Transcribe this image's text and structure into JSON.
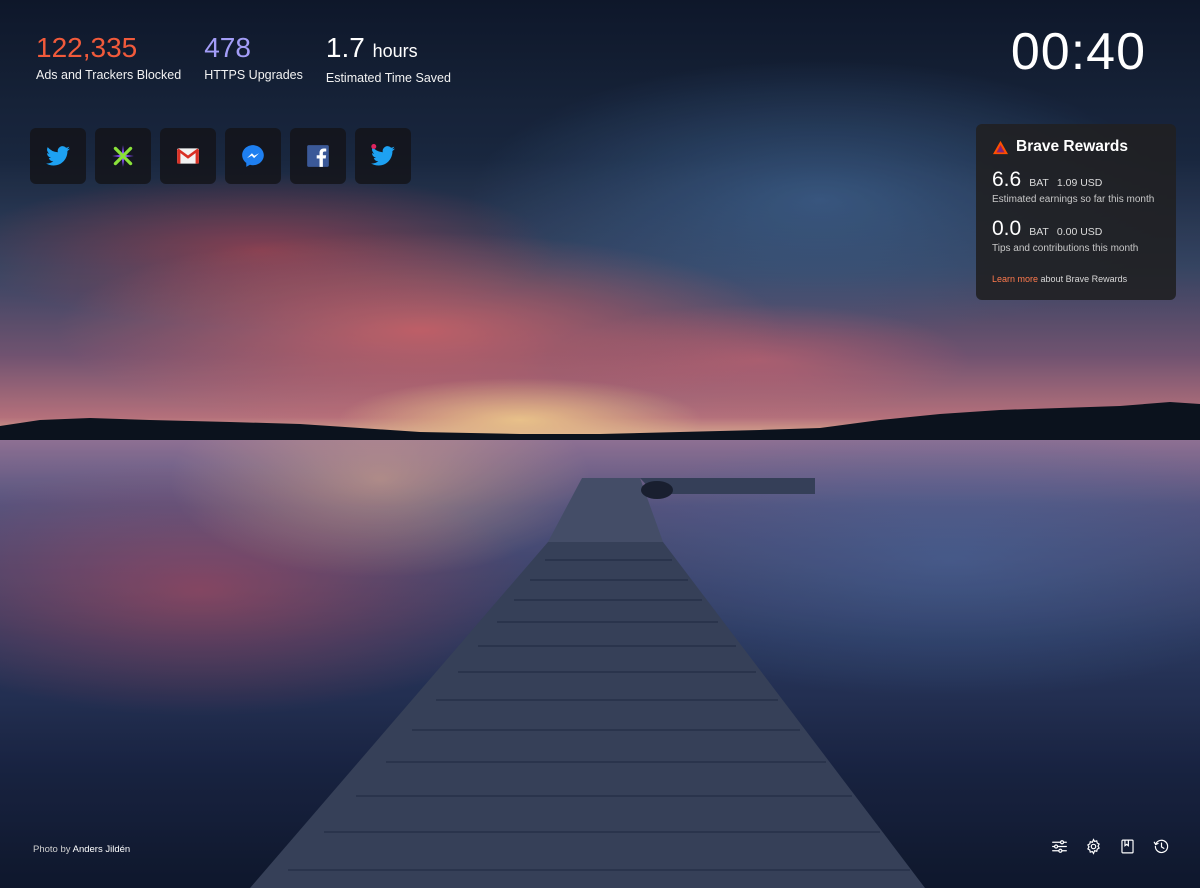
{
  "stats": {
    "ads_blocked": {
      "value": "122,335",
      "label": "Ads and Trackers Blocked",
      "color": "#f15a3b"
    },
    "https_upgrades": {
      "value": "478",
      "label": "HTTPS Upgrades",
      "color": "#a39df7"
    },
    "time_saved": {
      "value": "1.7",
      "unit": "hours",
      "label": "Estimated Time Saved"
    }
  },
  "clock": {
    "time": "00:40"
  },
  "top_sites": [
    {
      "name": "twitter",
      "icon": "twitter-icon"
    },
    {
      "name": "etrade",
      "icon": "etrade-icon"
    },
    {
      "name": "gmail",
      "icon": "gmail-icon"
    },
    {
      "name": "messenger",
      "icon": "messenger-icon"
    },
    {
      "name": "facebook",
      "icon": "facebook-icon"
    },
    {
      "name": "twitter",
      "icon": "twitter-notification-icon"
    }
  ],
  "rewards": {
    "title": "Brave Rewards",
    "earnings": {
      "amount": "6.6",
      "unit": "BAT",
      "usd": "1.09 USD",
      "description": "Estimated earnings so far this month"
    },
    "tips": {
      "amount": "0.0",
      "unit": "BAT",
      "usd": "0.00 USD",
      "description": "Tips and contributions this month"
    },
    "learn_more": {
      "link": "Learn more",
      "rest": "about Brave Rewards"
    }
  },
  "photo_credit": {
    "prefix": "Photo by",
    "author": "Anders Jildén"
  },
  "actions": [
    "customize-icon",
    "settings-icon",
    "bookmarks-icon",
    "history-icon"
  ]
}
